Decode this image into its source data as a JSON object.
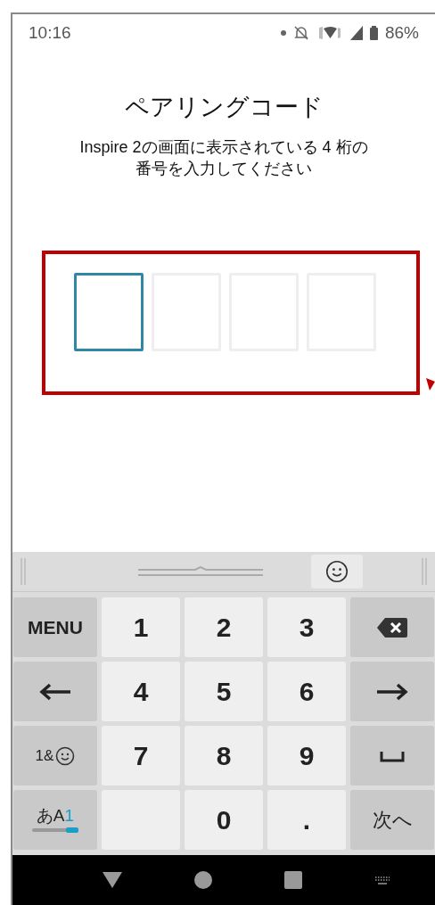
{
  "status_bar": {
    "time": "10:16",
    "battery": "86%"
  },
  "title": "ペアリングコード",
  "instruction": "Inspire 2の画面に表示されている 4 桁の番号を入力してください",
  "code_boxes": [
    {
      "selected": true
    },
    {
      "selected": false
    },
    {
      "selected": false
    },
    {
      "selected": false
    }
  ],
  "keyboard": {
    "rows": [
      [
        {
          "kind": "text",
          "label": "MENU"
        },
        {
          "kind": "text",
          "label": "1"
        },
        {
          "kind": "text",
          "label": "2"
        },
        {
          "kind": "text",
          "label": "3"
        },
        {
          "kind": "backspace"
        }
      ],
      [
        {
          "kind": "left"
        },
        {
          "kind": "text",
          "label": "4"
        },
        {
          "kind": "text",
          "label": "5"
        },
        {
          "kind": "text",
          "label": "6"
        },
        {
          "kind": "right"
        }
      ],
      [
        {
          "kind": "emoji-text",
          "label": "1&"
        },
        {
          "kind": "text",
          "label": "7"
        },
        {
          "kind": "text",
          "label": "8"
        },
        {
          "kind": "text",
          "label": "9"
        },
        {
          "kind": "space"
        }
      ],
      [
        {
          "kind": "mode",
          "label": "あA",
          "active": "1"
        },
        {
          "kind": "blank"
        },
        {
          "kind": "text",
          "label": "0"
        },
        {
          "kind": "text",
          "label": "."
        },
        {
          "kind": "text",
          "label": "次へ"
        }
      ]
    ]
  }
}
